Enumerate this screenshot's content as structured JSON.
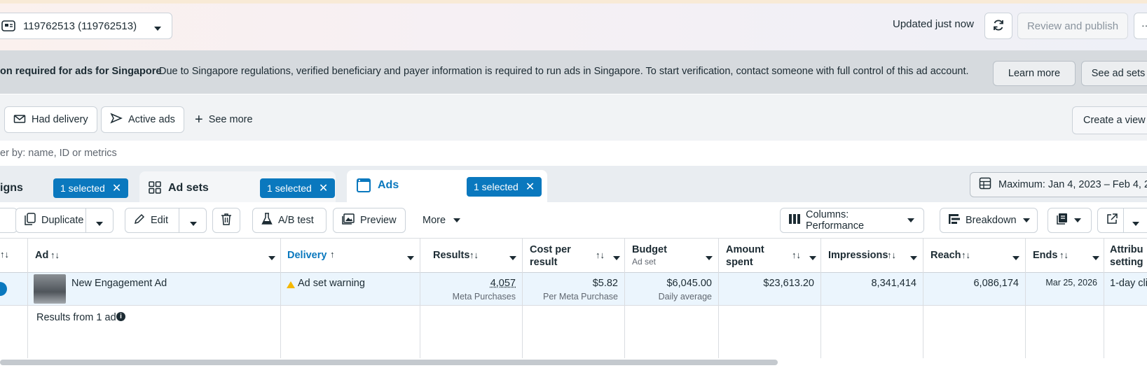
{
  "header": {
    "account_label": "119762513 (119762513)",
    "updated_text": "Updated just now",
    "review_label": "Review and publish",
    "overflow_label": "···"
  },
  "banner": {
    "title": "on required for ads for Singapore",
    "message": "Due to Singapore regulations, verified beneficiary and payer information is required to run ads in Singapore. To start verification, contact someone with full control of this ad account.",
    "learn_more": "Learn more",
    "see_ad_sets": "See ad sets"
  },
  "filters": {
    "had_delivery": "Had delivery",
    "active_ads": "Active ads",
    "see_more": "See more",
    "create_view": "Create a view"
  },
  "search": {
    "placeholder": "er by: name, ID or metrics"
  },
  "tabs": {
    "campaigns": {
      "label": "igns",
      "selected": "1 selected"
    },
    "ad_sets": {
      "label": "Ad sets",
      "selected": "1 selected"
    },
    "ads": {
      "label": "Ads",
      "selected": "1 selected"
    },
    "date_range": "Maximum: Jan 4, 2023 – Feb 4, 20"
  },
  "toolbar": {
    "duplicate": "Duplicate",
    "edit": "Edit",
    "ab_test": "A/B test",
    "preview": "Preview",
    "more": "More",
    "columns": "Columns: Performance",
    "breakdown": "Breakdown"
  },
  "table": {
    "headers": {
      "ad": "Ad",
      "delivery": "Delivery",
      "results": "Results",
      "cost_per_result_1": "Cost per",
      "cost_per_result_2": "result",
      "budget": "Budget",
      "budget_sub": "Ad set",
      "amount_spent_1": "Amount",
      "amount_spent_2": "spent",
      "impressions": "Impressions",
      "reach": "Reach",
      "ends": "Ends",
      "attribution_1": "Attribu",
      "attribution_2": "setting"
    },
    "row": {
      "ad_name": "New Engagement Ad",
      "delivery": "Ad set warning",
      "results": "4,057",
      "results_sub": "Meta Purchases",
      "cost": "$5.82",
      "cost_sub": "Per Meta Purchase",
      "budget": "$6,045.00",
      "budget_sub": "Daily average",
      "amount_spent": "$23,613.20",
      "impressions": "8,341,414",
      "reach": "6,086,174",
      "ends": "Mar 25, 2026",
      "attribution": "1-day cli"
    },
    "footer": {
      "results_text": "Results from 1 ad"
    }
  },
  "colors": {
    "accent": "#0a78be",
    "warning": "#f5b800",
    "banner_bg": "#d6dade"
  }
}
